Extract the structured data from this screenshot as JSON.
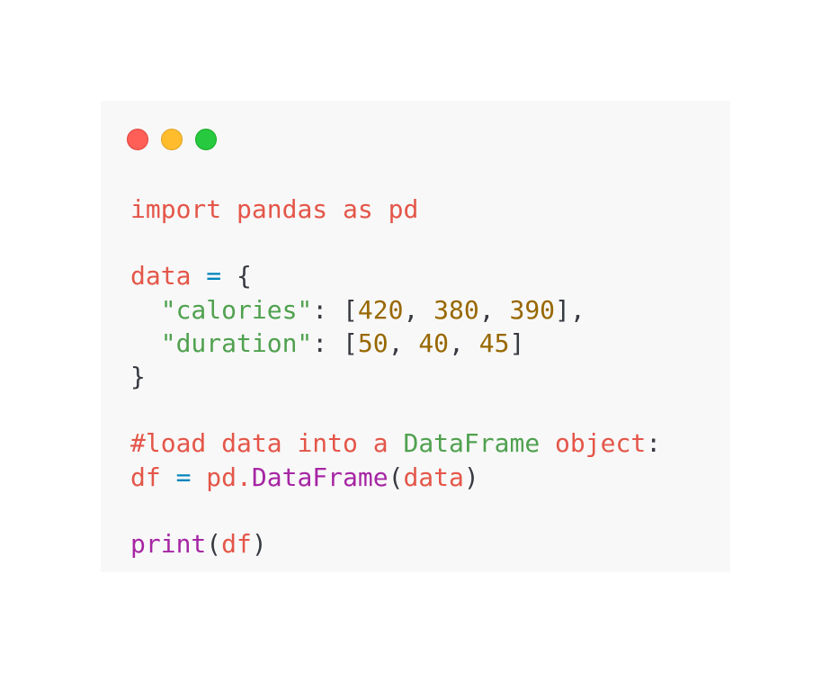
{
  "window": {
    "background": "#f8f8f8",
    "buttons": [
      {
        "name": "close-button",
        "color": "#ff5f56",
        "border": "#e0443e"
      },
      {
        "name": "minimize-button",
        "color": "#ffbd2e",
        "border": "#dea123"
      },
      {
        "name": "maximize-button",
        "color": "#27c93f",
        "border": "#1aab29"
      }
    ]
  },
  "colors": {
    "kw": "#e45649",
    "id": "#e45649",
    "op": "#0184bc",
    "pn": "#383a42",
    "str": "#50a14f",
    "num": "#986801",
    "fn": "#a626a4",
    "cm": "#e45649",
    "cmw": "#50a14f"
  },
  "code": {
    "language": "python",
    "lines": [
      [
        {
          "t": "kw",
          "v": "import"
        },
        {
          "t": "pn",
          "v": " "
        },
        {
          "t": "kw",
          "v": "pandas"
        },
        {
          "t": "pn",
          "v": " "
        },
        {
          "t": "kw",
          "v": "as"
        },
        {
          "t": "pn",
          "v": " "
        },
        {
          "t": "kw",
          "v": "pd"
        }
      ],
      [],
      [
        {
          "t": "id",
          "v": "data"
        },
        {
          "t": "pn",
          "v": " "
        },
        {
          "t": "op",
          "v": "="
        },
        {
          "t": "pn",
          "v": " {"
        }
      ],
      [
        {
          "t": "pn",
          "v": "  "
        },
        {
          "t": "str",
          "v": "\"calories\""
        },
        {
          "t": "pn",
          "v": ": ["
        },
        {
          "t": "num",
          "v": "420"
        },
        {
          "t": "pn",
          "v": ", "
        },
        {
          "t": "num",
          "v": "380"
        },
        {
          "t": "pn",
          "v": ", "
        },
        {
          "t": "num",
          "v": "390"
        },
        {
          "t": "pn",
          "v": "],"
        }
      ],
      [
        {
          "t": "pn",
          "v": "  "
        },
        {
          "t": "str",
          "v": "\"duration\""
        },
        {
          "t": "pn",
          "v": ": ["
        },
        {
          "t": "num",
          "v": "50"
        },
        {
          "t": "pn",
          "v": ", "
        },
        {
          "t": "num",
          "v": "40"
        },
        {
          "t": "pn",
          "v": ", "
        },
        {
          "t": "num",
          "v": "45"
        },
        {
          "t": "pn",
          "v": "]"
        }
      ],
      [
        {
          "t": "pn",
          "v": "}"
        }
      ],
      [],
      [
        {
          "t": "cm",
          "v": "#load"
        },
        {
          "t": "pn",
          "v": " "
        },
        {
          "t": "cm",
          "v": "data"
        },
        {
          "t": "pn",
          "v": " "
        },
        {
          "t": "cm",
          "v": "into"
        },
        {
          "t": "pn",
          "v": " "
        },
        {
          "t": "cm",
          "v": "a"
        },
        {
          "t": "pn",
          "v": " "
        },
        {
          "t": "cmw",
          "v": "DataFrame"
        },
        {
          "t": "pn",
          "v": " "
        },
        {
          "t": "cm",
          "v": "object"
        },
        {
          "t": "pn",
          "v": ":"
        }
      ],
      [
        {
          "t": "id",
          "v": "df"
        },
        {
          "t": "pn",
          "v": " "
        },
        {
          "t": "op",
          "v": "="
        },
        {
          "t": "pn",
          "v": " "
        },
        {
          "t": "id",
          "v": "pd"
        },
        {
          "t": "id",
          "v": "."
        },
        {
          "t": "fn",
          "v": "DataFrame"
        },
        {
          "t": "pn",
          "v": "("
        },
        {
          "t": "id",
          "v": "data"
        },
        {
          "t": "pn",
          "v": ")"
        }
      ],
      [],
      [
        {
          "t": "fn",
          "v": "print"
        },
        {
          "t": "pn",
          "v": "("
        },
        {
          "t": "id",
          "v": "df"
        },
        {
          "t": "pn",
          "v": ")"
        }
      ]
    ]
  }
}
